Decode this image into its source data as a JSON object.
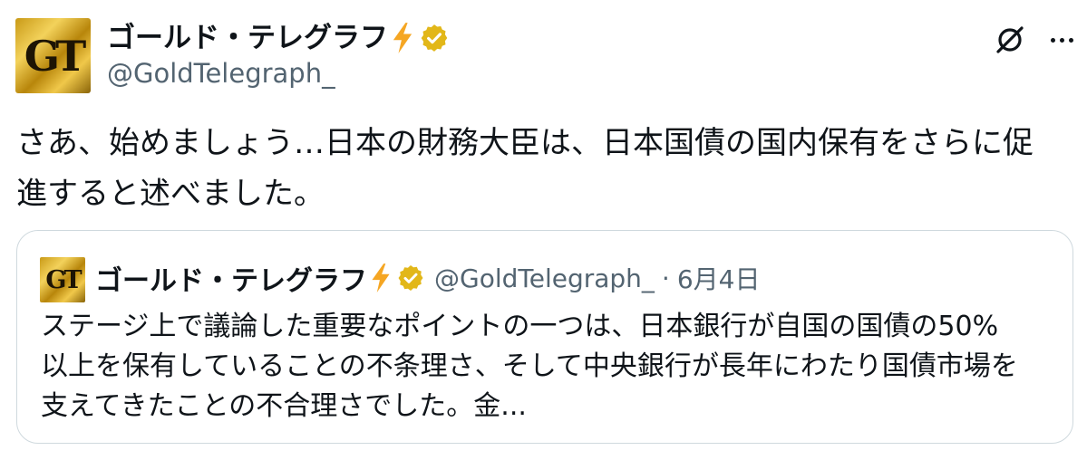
{
  "tweet": {
    "avatar_monogram": "GT",
    "display_name": "ゴールド・テレグラフ",
    "name_emoji": "lightning-icon",
    "verified_badge": "gold-verified-icon",
    "handle": "@GoldTelegraph_",
    "text": "さあ、始めましょう…日本の財務大臣は、日本国債の国内保有をさらに促\n進すると述べました。"
  },
  "header_actions": {
    "grok_icon": "grok-icon",
    "more_icon": "more-icon"
  },
  "quote": {
    "avatar_monogram": "GT",
    "display_name": "ゴールド・テレグラフ",
    "handle": "@GoldTelegraph_",
    "separator": "·",
    "date": "6月4日",
    "text": "ステージ上で議論した重要なポイントの一つは、日本銀行が自国の国債の50%\n以上を保有していることの不条理さ、そして中央銀行が長年にわたり国債市場を\n支えてきたことの不合理さでした。金..."
  },
  "colors": {
    "text": "#0f1419",
    "secondary": "#536471",
    "border": "#cfd9de",
    "verified_gold": "#e2b719",
    "bolt": "#f5a623"
  }
}
